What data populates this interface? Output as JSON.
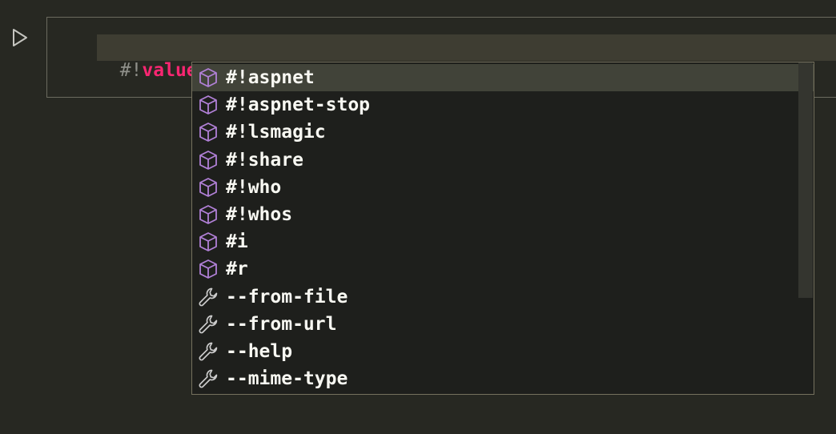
{
  "run_button": {
    "icon": "play-icon"
  },
  "editor": {
    "prefix": "#!",
    "typed": "value"
  },
  "suggestions": [
    {
      "label": "#!aspnet",
      "kind": "module",
      "icon": "cube-icon",
      "selected": true
    },
    {
      "label": "#!aspnet-stop",
      "kind": "module",
      "icon": "cube-icon"
    },
    {
      "label": "#!lsmagic",
      "kind": "module",
      "icon": "cube-icon"
    },
    {
      "label": "#!share",
      "kind": "module",
      "icon": "cube-icon"
    },
    {
      "label": "#!who",
      "kind": "module",
      "icon": "cube-icon"
    },
    {
      "label": "#!whos",
      "kind": "module",
      "icon": "cube-icon"
    },
    {
      "label": "#i",
      "kind": "module",
      "icon": "cube-icon"
    },
    {
      "label": "#r",
      "kind": "module",
      "icon": "cube-icon"
    },
    {
      "label": "--from-file",
      "kind": "property",
      "icon": "wrench-icon"
    },
    {
      "label": "--from-url",
      "kind": "property",
      "icon": "wrench-icon"
    },
    {
      "label": "--help",
      "kind": "property",
      "icon": "wrench-icon"
    },
    {
      "label": "--mime-type",
      "kind": "property",
      "icon": "wrench-icon"
    }
  ],
  "colors": {
    "background": "#272822",
    "keyword": "#f92672",
    "module_icon": "#b180d7",
    "property_icon": "#cccccc",
    "selected_row": "#414339"
  }
}
